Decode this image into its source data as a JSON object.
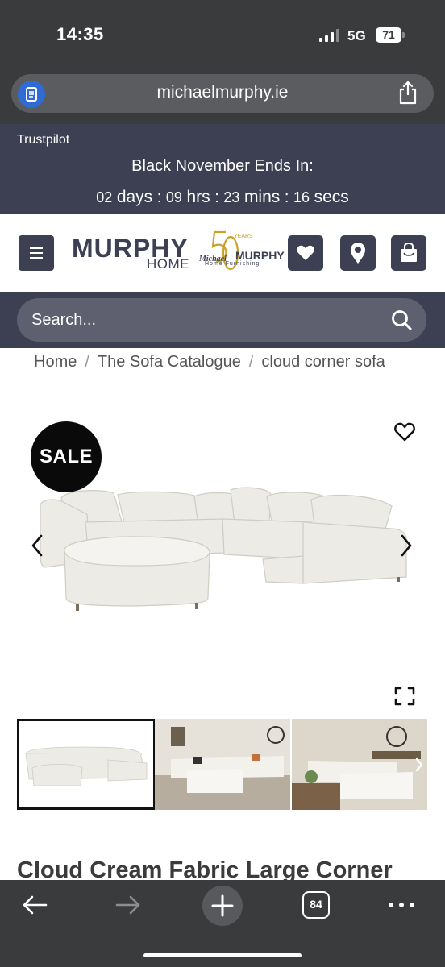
{
  "status_bar": {
    "time": "14:35",
    "network": "5G",
    "battery": "71"
  },
  "browser": {
    "url": "michaelmurphy.ie"
  },
  "promo": {
    "trustpilot": "Trustpilot",
    "title": "Black November Ends In:",
    "countdown": {
      "days": "02",
      "days_unit": "days",
      "hrs": "09",
      "hrs_unit": "hrs",
      "mins": "23",
      "mins_unit": "mins",
      "secs": "16",
      "secs_unit": "secs"
    }
  },
  "header": {
    "logo_main": "MURPHY",
    "logo_sub": "HOME",
    "logo_years": "YEARS",
    "logo_michael": "Michael",
    "logo_murphy": "MURPHY",
    "logo_tagline": "Home Furnishing"
  },
  "search": {
    "placeholder": "Search..."
  },
  "breadcrumb": [
    "Home",
    "The Sofa Catalogue",
    "cloud corner sofa"
  ],
  "product": {
    "badge": "SALE",
    "title": "Cloud Cream Fabric Large Corner"
  },
  "toolbar": {
    "tab_count": "84"
  },
  "colors": {
    "brand_navy": "#3d4053",
    "chrome": "#3a3b3d",
    "gold": "#c9a227"
  }
}
